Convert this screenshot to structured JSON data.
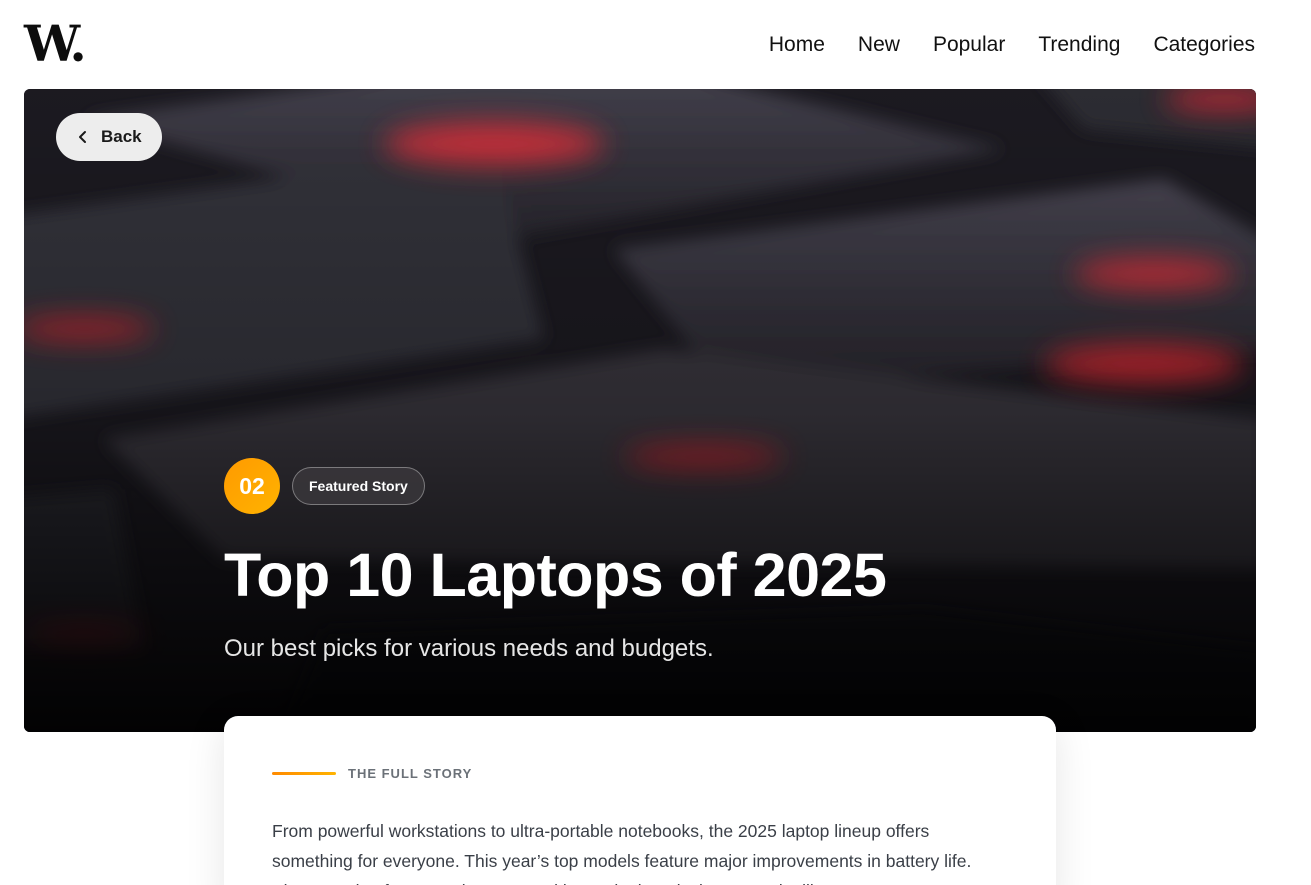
{
  "header": {
    "logo": "W.",
    "nav": [
      "Home",
      "New",
      "Popular",
      "Trending",
      "Categories"
    ]
  },
  "hero": {
    "back_label": "Back",
    "rank": "02",
    "tag": "Featured Story",
    "title": "Top 10 Laptops of 2025",
    "subtitle": "Our best picks for various needs and budgets."
  },
  "article": {
    "kicker": "THE FULL STORY",
    "body": "From powerful workstations to ultra-portable notebooks, the 2025 laptop lineup offers something for everyone. This year’s top models feature major improvements in battery life. Above, a plea for several ...top ...ranking ...single ...designs. Read ...lik..."
  },
  "colors": {
    "accent": "#ff9a00",
    "hero_bg": "#1a1820",
    "key_glow": "#e0303c"
  },
  "icons": {
    "back": "chevron-left-icon"
  }
}
